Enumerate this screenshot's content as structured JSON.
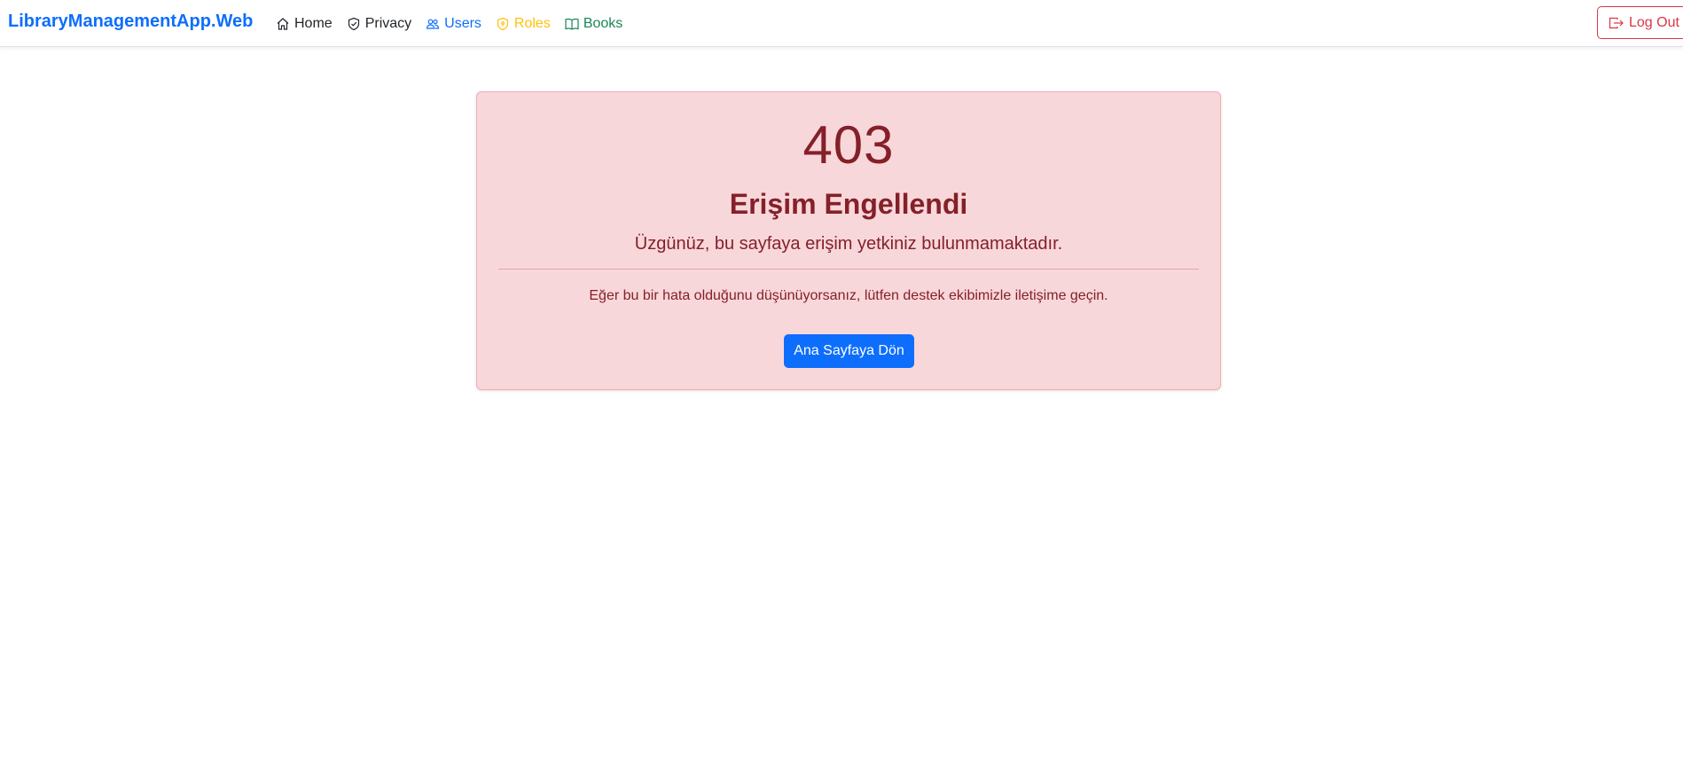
{
  "navbar": {
    "brand": "LibraryManagementApp.Web",
    "links": [
      {
        "label": "Home",
        "icon": "house-icon",
        "color": "#212529"
      },
      {
        "label": "Privacy",
        "icon": "shield-check-icon",
        "color": "#212529"
      },
      {
        "label": "Users",
        "icon": "people-icon",
        "color": "#0d6efd"
      },
      {
        "label": "Roles",
        "icon": "shield-lock-icon",
        "color": "#ffc107"
      },
      {
        "label": "Books",
        "icon": "book-icon",
        "color": "#198754"
      }
    ],
    "logout": {
      "label": "Log Out",
      "icon": "box-arrow-right-icon",
      "color": "#dc3545"
    }
  },
  "error": {
    "code": "403",
    "title": "Erişim Engellendi",
    "subtitle": "Üzgünüz, bu sayfaya erişim yetkiniz bulunmamaktadır.",
    "help": "Eğer bu bir hata olduğunu düşünüyorsanız, lütfen destek ekibimizle iletişime geçin.",
    "button": "Ana Sayfaya Dön"
  },
  "colors": {
    "brand": "#0d6efd",
    "alert_bg": "#f8d7da",
    "alert_text": "#842029",
    "primary_button": "#0d6efd",
    "danger": "#dc3545"
  }
}
